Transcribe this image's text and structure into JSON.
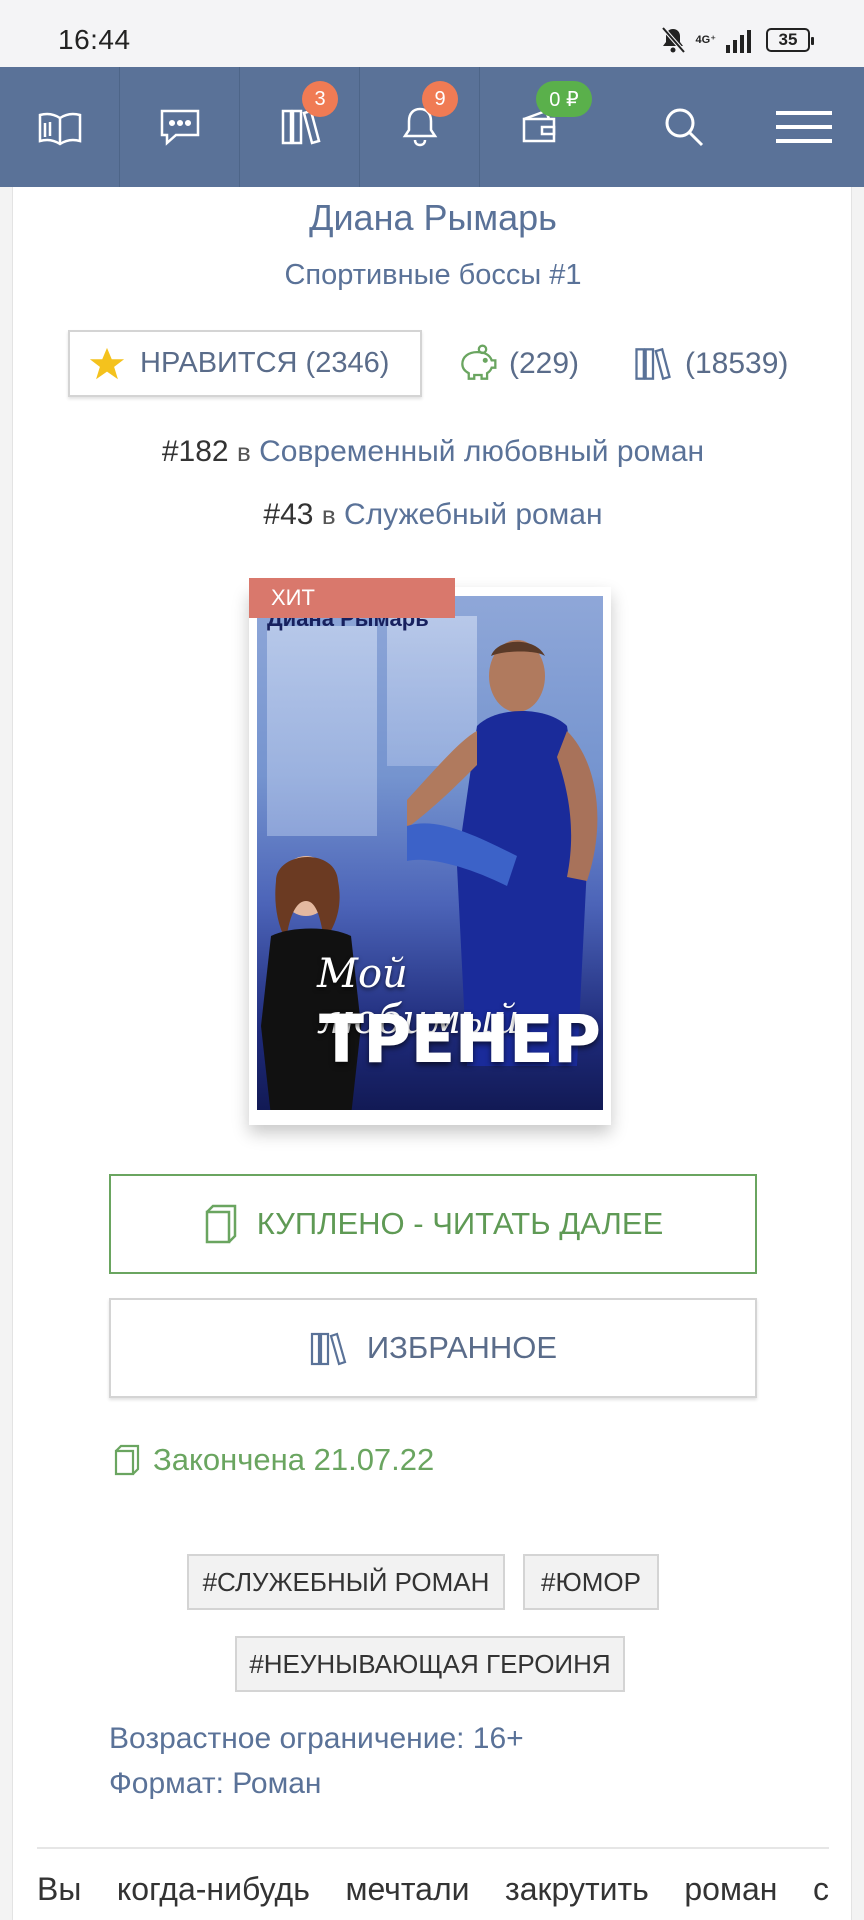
{
  "status_bar": {
    "time": "16:44",
    "network": "4G⁺",
    "battery": "35"
  },
  "nav": {
    "books_badge": "3",
    "notifications_badge": "9",
    "wallet_badge": "0 ₽"
  },
  "book": {
    "author": "Диана Рымарь",
    "series": "Спортивные боссы #1",
    "like_label": "НРАВИТСЯ (2346)",
    "rewards_count": "(229)",
    "library_count": "(18539)",
    "ranks": [
      {
        "position": "#182",
        "in": "в",
        "category": "Современный любовный роман"
      },
      {
        "position": "#43",
        "in": "в",
        "category": "Служебный роман"
      }
    ],
    "badge": "ХИТ",
    "cover": {
      "author": "Диана Рымарь",
      "title_line1": "Мой любимый",
      "title_line2": "ТРЕНЕР"
    },
    "read_button": "КУПЛЕНО - ЧИТАТЬ ДАЛЕЕ",
    "favorite_button": "ИЗБРАННОЕ",
    "status": "Закончена 21.07.22",
    "tags": [
      "#СЛУЖЕБНЫЙ РОМАН",
      "#ЮМОР",
      "#НЕУНЫВАЮЩАЯ ГЕРОИНЯ"
    ],
    "age_restriction": "Возрастное ограничение: 16+",
    "format": "Формат: Роман",
    "description_start": "Вы когда-нибудь мечтали закрутить роман с"
  },
  "colors": {
    "nav_bg": "#5a7298",
    "accent_green": "#6aa560",
    "link_blue": "#5a7298",
    "badge_orange": "#f07b54",
    "hit_red": "#d9786c"
  }
}
